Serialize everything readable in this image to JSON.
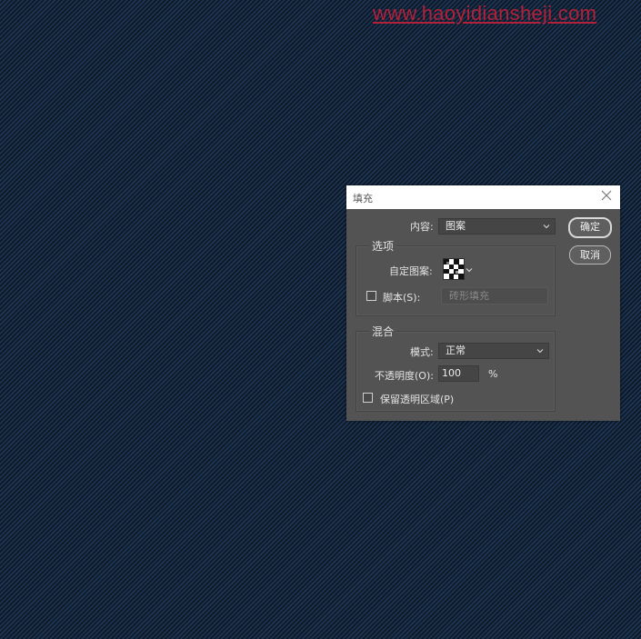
{
  "watermark": "www.haoyidiansheji.com",
  "dialog": {
    "title": "填充",
    "content_label": "内容:",
    "content_value": "图案",
    "ok_label": "确定",
    "cancel_label": "取消",
    "options": {
      "title": "选项",
      "custom_pattern_label": "自定图案:",
      "script_label": "脚本(S):",
      "script_value": "砖形填充",
      "script_checked": false
    },
    "blend": {
      "title": "混合",
      "mode_label": "模式:",
      "mode_value": "正常",
      "opacity_label": "不透明度(O):",
      "opacity_value": "100",
      "opacity_unit": "%",
      "preserve_label": "保留透明区域(P)",
      "preserve_checked": false
    }
  },
  "colors": {
    "dialog_bg": "#535353",
    "canvas_stripe_light": "#1d3656",
    "canvas_stripe_dark": "#0f1a28",
    "watermark": "#b3203a"
  }
}
